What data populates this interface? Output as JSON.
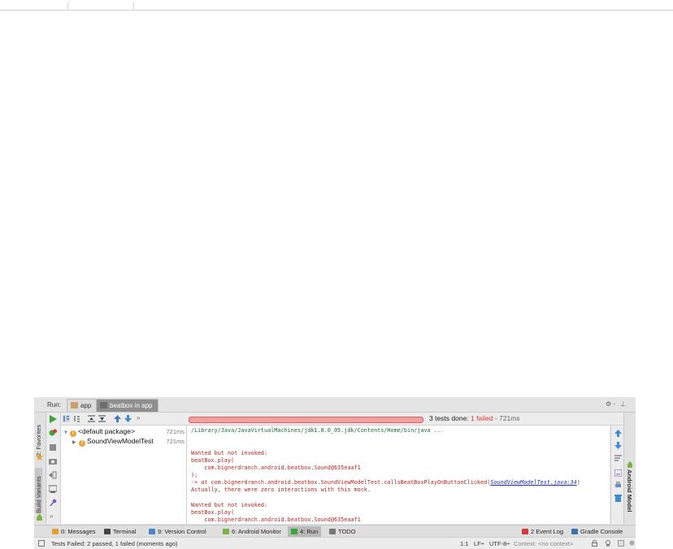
{
  "run_panel": {
    "run_label": "Run:",
    "tabs": [
      {
        "label": "app"
      },
      {
        "label": "beatbox in app"
      }
    ],
    "header_right": "⚙- ⊥"
  },
  "left_strip": {
    "favorites": "2: Favorites",
    "build_variants": "Build Variants"
  },
  "right_strip": {
    "android_model": "Android Model"
  },
  "progress": {
    "fraction": 1.0,
    "summary_prefix": "3 tests done:",
    "failed_text": "1 failed",
    "duration": "- 721ms"
  },
  "tree": {
    "root": {
      "label": "<default package>",
      "time": "721ms"
    },
    "child": {
      "label": "SoundViewModelTest",
      "time": "721ms"
    }
  },
  "console": {
    "path_line": "/Library/Java/JavaVirtualMachines/jdk1.8.0_05.jdk/Contents/Home/bin/java",
    "path_ellipsis": "...",
    "block1": {
      "l1": "Wanted but not invoked:",
      "l2": "beatBox.play(",
      "l3": "    com.bignerdranch.android.beatbox.Sound@635eaaf1",
      "l4": ");",
      "l5_prefix": "-> at com.bignerdranch.android.beatbox.SoundViewModelTest.callsBeatBoxPlayOnButtonClicked(",
      "l5_link": "SoundViewModelTest.java:34",
      "l5_suffix": ")",
      "l6": "Actually, there were zero interactions with this mock."
    },
    "block2": {
      "l1": "Wanted but not invoked:",
      "l2": "beatBox.play(",
      "l3": "    com.bignerdranch.android.beatbox.Sound@635eaaf1"
    }
  },
  "bottom_tools": {
    "messages": "0: Messages",
    "terminal": "Terminal",
    "version_control": "9: Version Control",
    "android_monitor": "6: Android Monitor",
    "run": "4: Run",
    "todo": "TODO",
    "event_log": "2 Event Log",
    "gradle_console": "Gradle Console"
  },
  "status": {
    "message": "Tests Failed: 2 passed, 1 failed (moments ago)",
    "position": "1:1",
    "line_sep": "LF÷",
    "encoding": "UTF-8÷",
    "context": "Context: <no context>"
  },
  "colors": {
    "progress_fail": "#f08080",
    "error_text": "#b3261e",
    "path_text": "#1d6b3b",
    "link_text": "#1b2fbf"
  }
}
